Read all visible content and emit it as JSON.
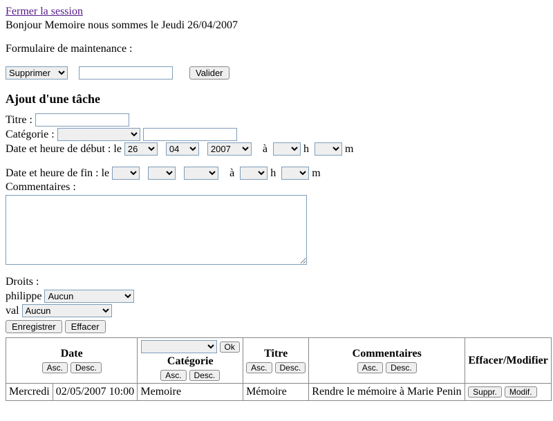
{
  "header": {
    "close_link": "Fermer la session",
    "greeting": "Bonjour Memoire nous sommes le Jeudi 26/04/2007"
  },
  "maintenance": {
    "label": "Formulaire de maintenance :",
    "action_selected": "Supprimer",
    "input_value": "",
    "validate_label": "Valider"
  },
  "add_task": {
    "heading": "Ajout d'une tâche",
    "title_label": "Titre :",
    "title_value": "",
    "category_label": "Catégorie :",
    "category_selected": "",
    "category_text_value": "",
    "start_label": "Date et heure de début : le",
    "start_day": "26",
    "start_month": "04",
    "start_year": "2007",
    "at_label": "à",
    "h_label": "h",
    "m_label": "m",
    "start_hour": "",
    "start_min": "",
    "end_label": "Date et heure de fin : le",
    "end_day": "",
    "end_month": "",
    "end_year": "",
    "end_hour": "",
    "end_min": "",
    "comments_label": "Commentaires :",
    "comments_value": "",
    "rights_label": "Droits :",
    "rights_users": [
      {
        "name": "philippe",
        "selected": "Aucun"
      },
      {
        "name": "val",
        "selected": "Aucun"
      }
    ],
    "save_label": "Enregistrer",
    "clear_label": "Effacer"
  },
  "table": {
    "filter_cat_selected": "",
    "ok_label": "Ok",
    "headers": {
      "date": "Date",
      "category": "Catégorie",
      "title": "Titre",
      "comments": "Commentaires",
      "actions": "Effacer/Modifier"
    },
    "sort": {
      "asc": "Asc.",
      "desc": "Desc."
    },
    "rows": [
      {
        "dayname": "Mercredi",
        "datetime": "02/05/2007 10:00",
        "category": "Memoire",
        "title": "Mémoire",
        "comments": "Rendre le mémoire à Marie Penin",
        "delete_label": "Suppr.",
        "edit_label": "Modif."
      }
    ]
  }
}
